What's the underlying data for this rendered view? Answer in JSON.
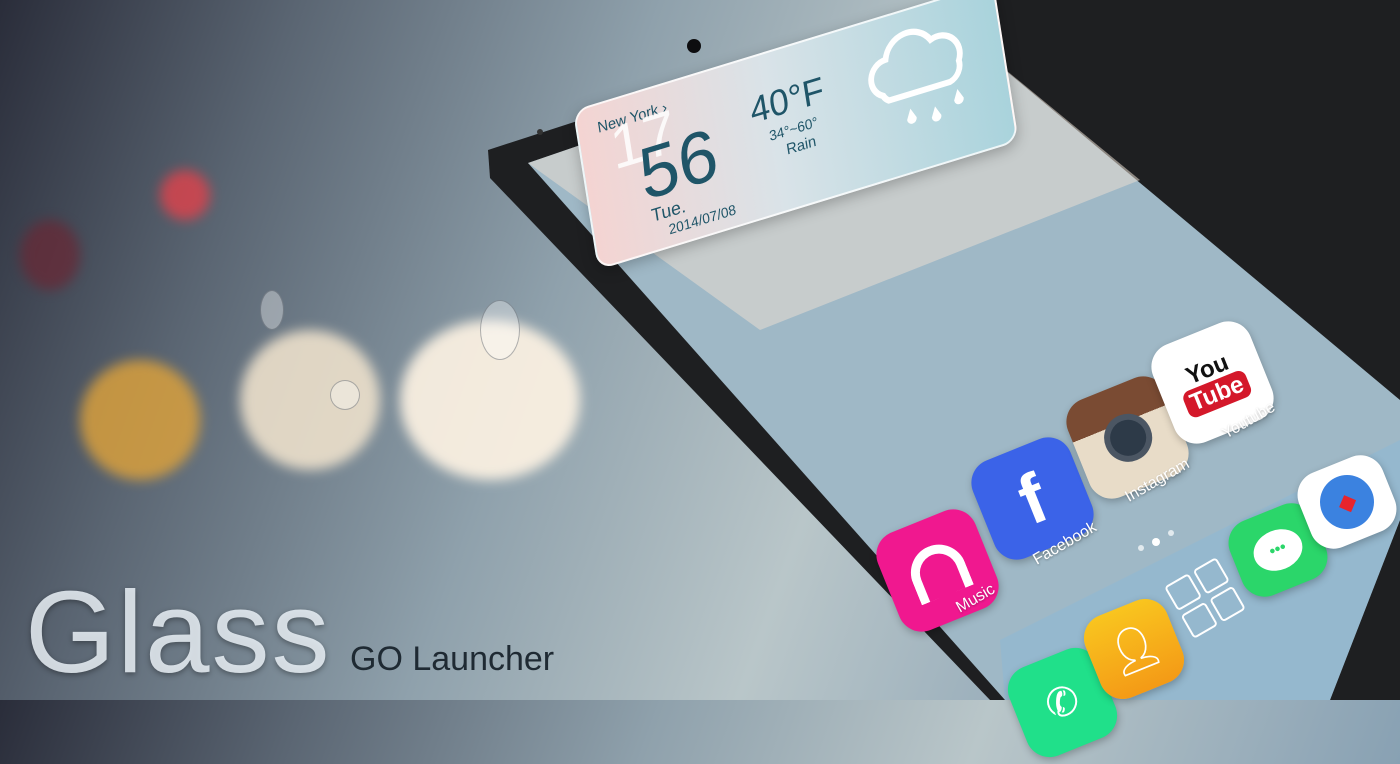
{
  "branding": {
    "title": "Glass",
    "subtitle": "GO Launcher"
  },
  "widget": {
    "city": "New York ›",
    "hour": "17",
    "minute": "56",
    "day": "Tue.",
    "date": "2014/07/08",
    "temperature": "40°F",
    "range": "34°~60°",
    "condition": "Rain",
    "weather_icon": "cloud-rain-icon"
  },
  "status": {
    "refresh_icon": "refresh-icon",
    "signal_icon": "signal-icon"
  },
  "apps": [
    {
      "label": "Music",
      "color": "#f0188f",
      "icon": "headphones-icon"
    },
    {
      "label": "Facebook",
      "color": "#3b63e8",
      "icon": "facebook-icon"
    },
    {
      "label": "Instagram",
      "color": "#e8dcc8",
      "icon": "instagram-icon"
    },
    {
      "label": "Youtube",
      "color": "#ffffff",
      "icon": "youtube-icon",
      "text_top": "You",
      "text_bottom": "Tube"
    }
  ],
  "dock": [
    {
      "name": "phone",
      "color": "#20e08a",
      "icon": "phone-icon"
    },
    {
      "name": "contacts",
      "color": "#f6a81a",
      "icon": "contact-icon"
    },
    {
      "name": "app-drawer",
      "icon": "grid-icon"
    },
    {
      "name": "messages",
      "color": "#2bd66a",
      "icon": "chat-icon"
    },
    {
      "name": "browser",
      "color": "#ffffff",
      "icon": "compass-icon"
    }
  ],
  "page_indicator": {
    "pages": 3,
    "current": 2
  }
}
